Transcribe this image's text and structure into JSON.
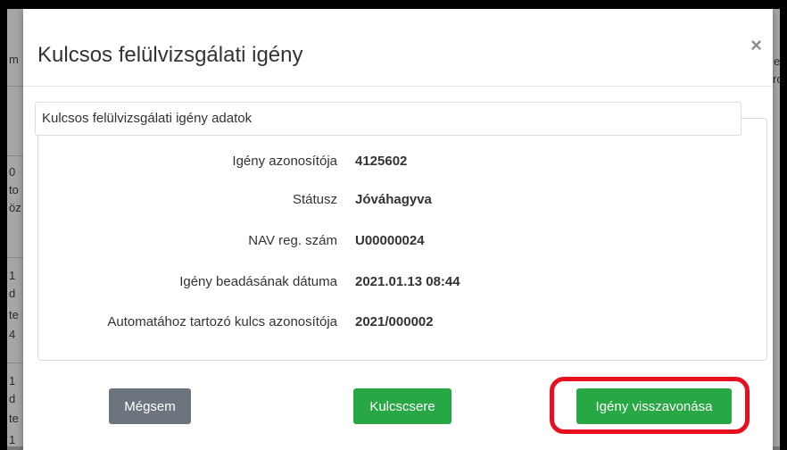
{
  "background": {
    "fragments_left": [
      "m",
      "0",
      "to",
      "öz",
      "1",
      "d",
      "te",
      "4",
      "1",
      "d",
      "te",
      "1"
    ],
    "fragments_right": [
      "e",
      "rc"
    ]
  },
  "modal": {
    "title": "Kulcsos felülvizsgálati igény",
    "close_label": "×",
    "panel_heading": "Kulcsos felülvizsgálati igény adatok",
    "fields": [
      {
        "label": "Igény azonosítója",
        "value": "4125602"
      },
      {
        "label": "Státusz",
        "value": "Jóváhagyva"
      },
      {
        "label": "NAV reg. szám",
        "value": "U00000024"
      },
      {
        "label": "Igény beadásának dátuma",
        "value": "2021.01.13 08:44"
      },
      {
        "label": "Automatához tartozó kulcs azonosítója",
        "value": "2021/000002"
      }
    ],
    "buttons": {
      "cancel": "Mégsem",
      "swap": "Kulcscsere",
      "withdraw": "Igény visszavonása"
    }
  },
  "colors": {
    "cancel_button": "#6c757d",
    "primary_green": "#28a745",
    "highlight_ring": "#e8101e"
  }
}
